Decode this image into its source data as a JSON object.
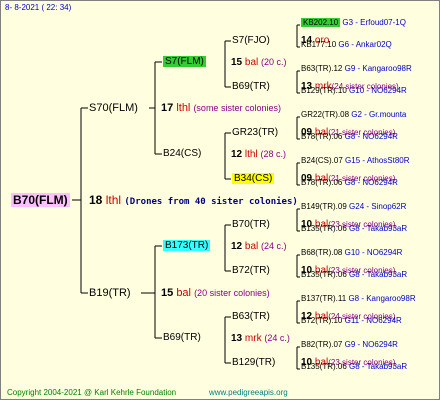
{
  "header": {
    "date": "8- 8-2021 ( 22: 34)"
  },
  "footer": {
    "copyright": "Copyright 2004-2021 @ Karl Kehrle Foundation",
    "website": "www.pedigreeapis.org"
  },
  "root": {
    "name": "B70(FLM)",
    "drones_num": "18",
    "drones_type": "lthl",
    "drones_note": "(Drones from 40 sister colonies)"
  },
  "gen2": [
    {
      "name": "S70(FLM)",
      "num": "17",
      "type": "lthl",
      "note": "(some sister colonies)"
    },
    {
      "name": "B19(TR)",
      "num": "15",
      "type": "bal",
      "note": "(20 sister colonies)"
    }
  ],
  "gen3": [
    {
      "name": "S7(FLM)",
      "num": "15",
      "type": "bal",
      "note": "(20 c.)"
    },
    {
      "name": "B24(CS)",
      "num": "12",
      "type": "lthl",
      "note": "(28 c.)"
    },
    {
      "name": "B173(TR)",
      "num": "12",
      "type": "bal",
      "note": "(24 c.)"
    },
    {
      "name": "B69(TR)",
      "num": "13",
      "type": "mrk",
      "note": "(24 c.)"
    }
  ],
  "gen4": [
    {
      "name": "S7(FJO)",
      "num": "14",
      "type": "oro",
      "note": ""
    },
    {
      "name": "B69(TR)",
      "num": "13",
      "type": "mrk",
      "note": "(24 sister colonies)"
    },
    {
      "name": "GR23(TR)",
      "num": "09",
      "type": "bal",
      "note": "(21 sister colonies)"
    },
    {
      "name": "B34(CS)",
      "num": "09",
      "type": "bal",
      "note": "(21 sister colonies)"
    },
    {
      "name": "B70(TR)",
      "num": "10",
      "type": "bal",
      "note": "(23 sister colonies)"
    },
    {
      "name": "B72(TR)",
      "num": "10",
      "type": "bal",
      "note": "(23 sister colonies)"
    },
    {
      "name": "B63(TR)",
      "num": "12",
      "type": "bal",
      "note": "(24 sister colonies)"
    },
    {
      "name": "B129(TR)",
      "num": "10",
      "type": "bal",
      "note": "(23 sister colonies)"
    }
  ],
  "gen5": [
    {
      "name": "KB202.10",
      "src": "G3 - Erfoud07-1Q"
    },
    {
      "name": "KB177.10",
      "src": "G6 - Ankar02Q"
    },
    {
      "name": "B63(TR).12",
      "src": "G9 - Kangaroo98R"
    },
    {
      "name": "B129(TR).10",
      "src": "G10 - NO6294R"
    },
    {
      "name": "GR22(TR).08",
      "src": "G2 - Gr.mounta"
    },
    {
      "name": "B78(TR).06",
      "src": "G8 - NO6294R"
    },
    {
      "name": "B24(CS).07",
      "src": "G15 - AthosSt80R"
    },
    {
      "name": "B78(TR).06",
      "src": "G8 - NO6294R"
    },
    {
      "name": "B149(TR).09",
      "src": "G24 - Sinop62R"
    },
    {
      "name": "B135(TR).06",
      "src": "G8 - Takab93aR"
    },
    {
      "name": "B68(TR).08",
      "src": "G10 - NO6294R"
    },
    {
      "name": "B135(TR).06",
      "src": "G8 - Takab93aR"
    },
    {
      "name": "B137(TR).11",
      "src": "G8 - Kangaroo98R"
    },
    {
      "name": "B72(TR).10",
      "src": "G11 - NO6294R"
    },
    {
      "name": "B82(TR).07",
      "src": "G9 - NO6294R"
    },
    {
      "name": "B135(TR).06",
      "src": "G8 - Takab93aR"
    }
  ],
  "highlight_colors": {
    "green": "#33cc33",
    "cyan": "#33ffff",
    "yellow": "#ffff00",
    "pink": "#ffc0ff"
  }
}
